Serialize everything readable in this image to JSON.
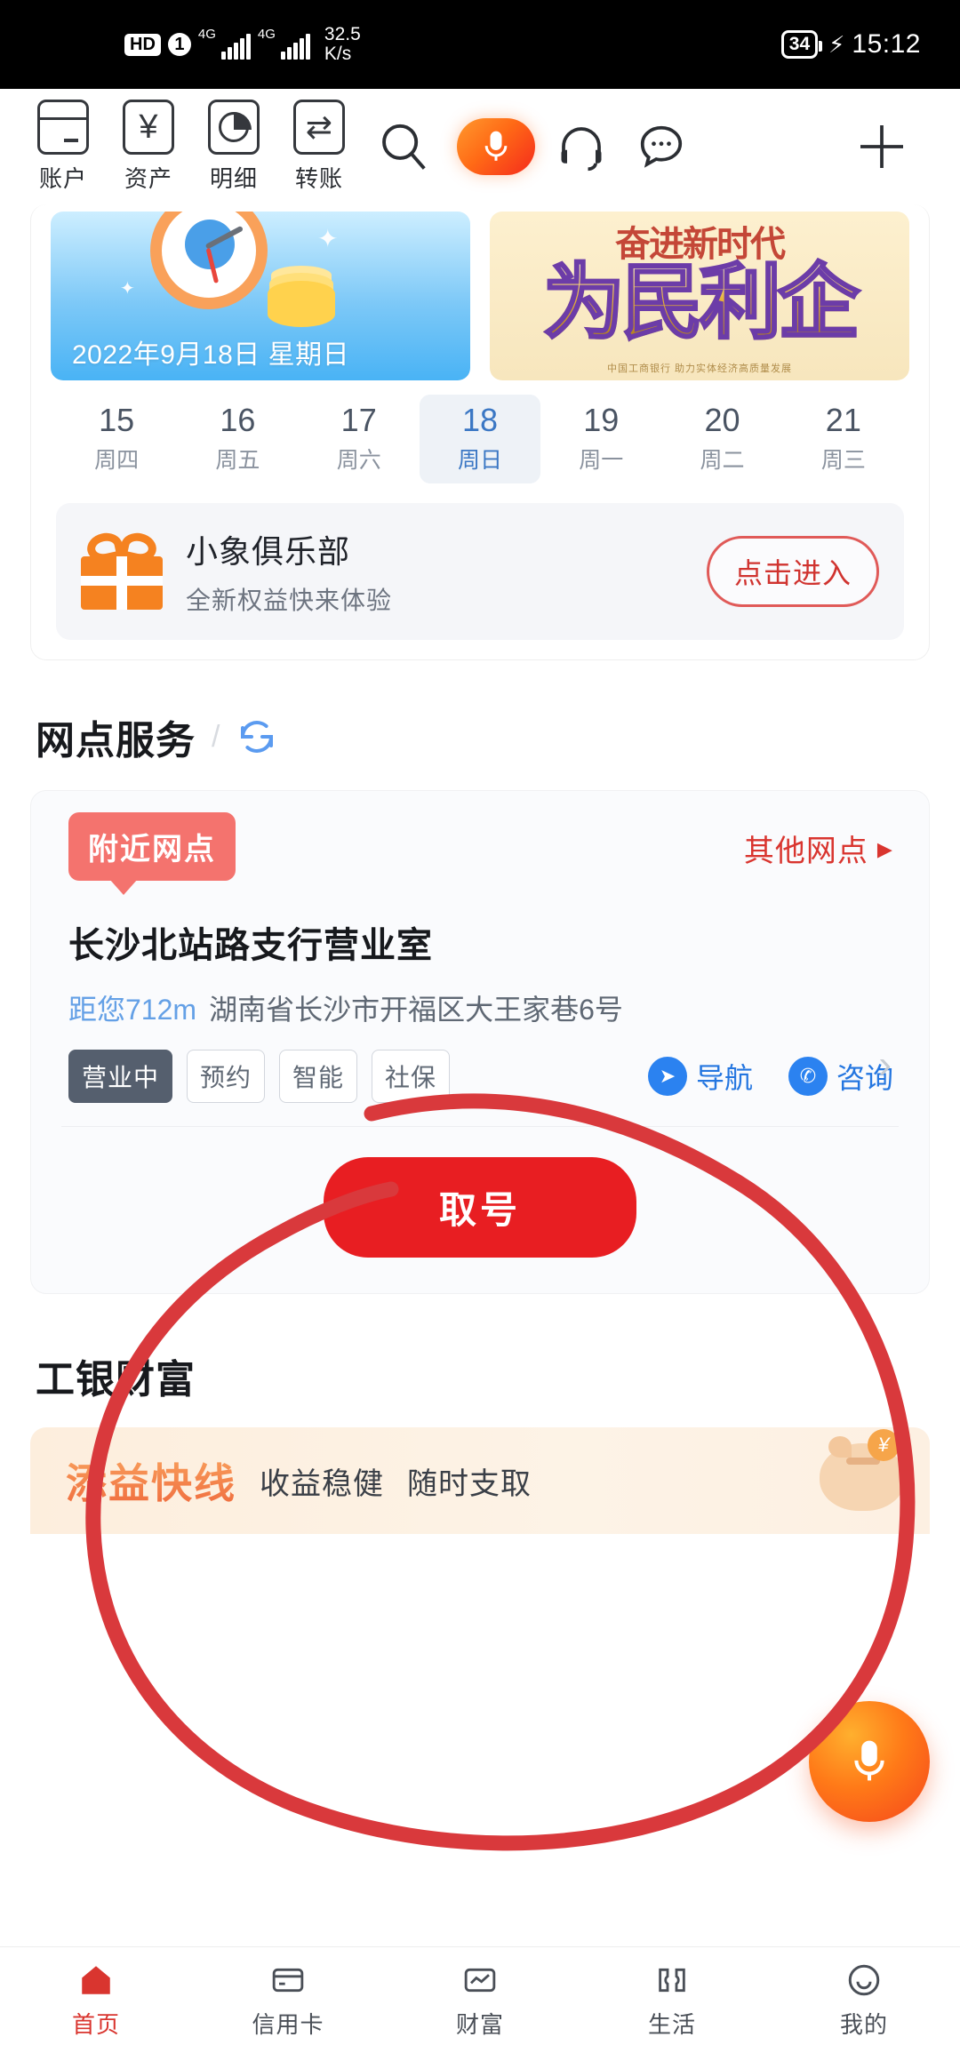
{
  "status_bar": {
    "hd": "HD",
    "sim": "1",
    "net1": "4G",
    "net2": "4G",
    "speed_value": "32.5",
    "speed_unit": "K/s",
    "battery": "34",
    "charging_icon": "bolt-icon",
    "time": "15:12"
  },
  "top_nav": {
    "items": [
      {
        "label": "账户",
        "icon": "card-icon"
      },
      {
        "label": "资产",
        "icon": "yen-icon"
      },
      {
        "label": "明细",
        "icon": "pie-chart-icon"
      },
      {
        "label": "转账",
        "icon": "transfer-icon"
      }
    ],
    "search_icon": "search-icon",
    "mic_icon": "microphone-icon",
    "headset_icon": "headset-icon",
    "chat_icon": "chat-bubble-icon",
    "plus_icon": "plus-icon"
  },
  "banners": {
    "left": {
      "date_text": "2022年9月18日 星期日",
      "art": "clock-coins-illustration"
    },
    "right": {
      "title": "为民利企",
      "subtitle": "奋进新时代",
      "footer": "中国工商银行 助力实体经济高质量发展"
    }
  },
  "calendar": {
    "days": [
      {
        "day": "15",
        "weekday": "周四",
        "selected": false
      },
      {
        "day": "16",
        "weekday": "周五",
        "selected": false
      },
      {
        "day": "17",
        "weekday": "周六",
        "selected": false
      },
      {
        "day": "18",
        "weekday": "周日",
        "selected": true
      },
      {
        "day": "19",
        "weekday": "周一",
        "selected": false
      },
      {
        "day": "20",
        "weekday": "周二",
        "selected": false
      },
      {
        "day": "21",
        "weekday": "周三",
        "selected": false
      }
    ]
  },
  "club_card": {
    "icon": "gift-icon",
    "title": "小象俱乐部",
    "subtitle": "全新权益快来体验",
    "button": "点击进入"
  },
  "branch_section": {
    "title": "网点服务",
    "divider": "/",
    "refresh_icon": "refresh-icon",
    "badge": "附近网点",
    "other_link": "其他网点",
    "other_link_arrow": "▸",
    "name": "长沙北站路支行营业室",
    "distance": "距您712m",
    "address": "湖南省长沙市开福区大王家巷6号",
    "chevron": "›",
    "tags": [
      {
        "label": "营业中",
        "highlight": true
      },
      {
        "label": "预约",
        "highlight": false
      },
      {
        "label": "智能",
        "highlight": false
      },
      {
        "label": "社保",
        "highlight": false
      }
    ],
    "actions": [
      {
        "label": "导航",
        "icon": "navigation-icon"
      },
      {
        "label": "咨询",
        "icon": "phone-icon"
      }
    ],
    "take_number_button": "取号"
  },
  "wealth_section": {
    "title": "工银财富",
    "product": {
      "name": "添益快线",
      "tags": [
        "收益稳健",
        "随时支取"
      ],
      "art": "piggy-bank-icon"
    }
  },
  "bottom_nav": {
    "items": [
      {
        "label": "首页",
        "icon": "home-icon",
        "active": true
      },
      {
        "label": "信用卡",
        "icon": "credit-card-icon",
        "active": false
      },
      {
        "label": "财富",
        "icon": "wealth-chart-icon",
        "active": false
      },
      {
        "label": "生活",
        "icon": "life-ticket-icon",
        "active": false
      },
      {
        "label": "我的",
        "icon": "profile-icon",
        "active": false
      }
    ]
  },
  "floating_button": {
    "icon": "microphone-icon"
  },
  "annotation": {
    "shape": "hand-drawn-red-circle",
    "color": "#d9393c"
  },
  "colors": {
    "brand_red": "#d9352f",
    "accent_orange": "#f58220",
    "link_blue": "#2476e0",
    "selected_blue": "#3b77c4"
  }
}
